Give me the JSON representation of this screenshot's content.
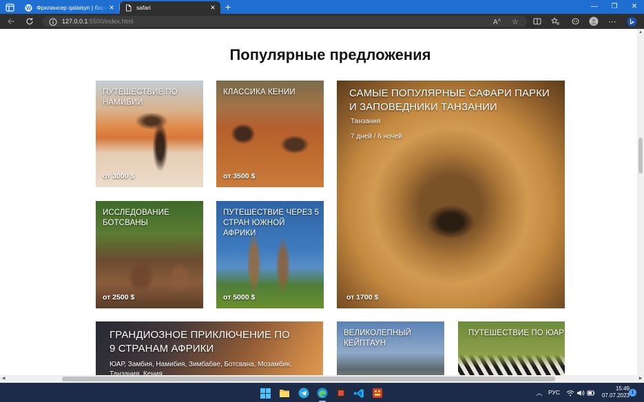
{
  "theme": {
    "tab_strip": "#1f6fd2",
    "toolbar": "#2f2f2f",
    "page_background": "#ffffff",
    "taskbar": "#1c2b47"
  },
  "browser": {
    "tabs": [
      {
        "title": "Фрилансер qalaisyn | биржа фр",
        "icon": "w-favicon-icon",
        "active": false
      },
      {
        "title": "safari",
        "icon": "page-icon",
        "active": true
      }
    ],
    "address": {
      "host": "127.0.0.1",
      "path": ":5500/index.html"
    }
  },
  "page": {
    "heading": "Популярные предложения",
    "cards": [
      {
        "title": "ПУТЕШЕСТВИЕ ПО НАМИБИИ",
        "price": "от 3000 $"
      },
      {
        "title": "КЛАССИКА КЕНИИ",
        "price": "от 3500 $"
      },
      {
        "title": "САМЫЕ ПОПУЛЯРНЫЕ САФАРИ ПАРКИ И ЗАПОВЕДНИКИ ТАНЗАНИИ",
        "country": "Танзания",
        "duration": "7 дней / 6 ночей",
        "price": "от 1700 $"
      },
      {
        "title": "ИССЛЕДОВАНИЕ БОТСВАНЫ",
        "price": "от 2500 $"
      },
      {
        "title": "ПУТЕШЕСТВИЕ ЧЕРЕЗ 5 СТРАН ЮЖНОЙ АФРИКИ",
        "price": "от 5000 $"
      },
      {
        "title": "ГРАНДИОЗНОЕ ПРИКЛЮЧЕНИЕ ПО 9 СТРАНАМ АФРИКИ",
        "subtitle": "ЮАР, Замбия, Намибия, Зимбабве, Ботсвана, Мозамбик, Танзания, Кения"
      },
      {
        "title": "ВЕЛИКОЛЕПНЫЙ КЕЙПТАУН"
      },
      {
        "title": "ПУТЕШЕСТВИЕ ПО ЮАР"
      }
    ]
  },
  "taskbar": {
    "language": "РУС",
    "time": "15:49",
    "date": "07.07.2023",
    "notifications": "1"
  }
}
